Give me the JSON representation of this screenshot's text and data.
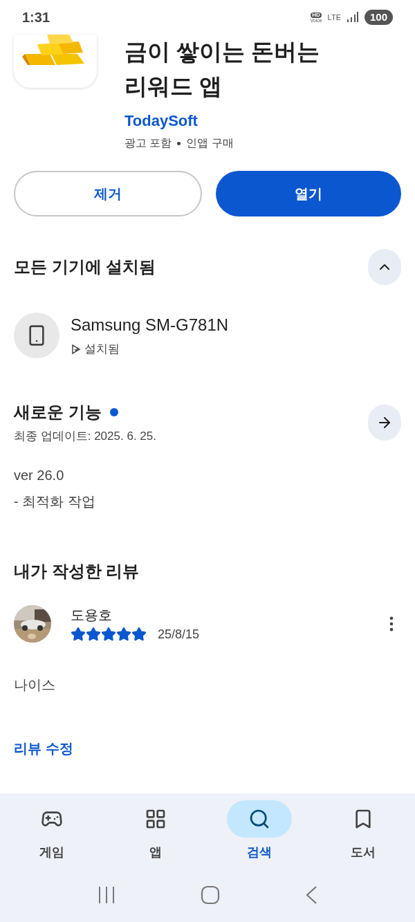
{
  "status_bar": {
    "time": "1:31",
    "hd": "HD",
    "voice": "Voice",
    "network": "LTE",
    "battery": "100"
  },
  "app": {
    "title_lines": [
      "금이 쌓이는 돈버는",
      "리워드 앱"
    ],
    "developer": "TodaySoft",
    "meta": [
      "광고 포함",
      "인앱 구매"
    ]
  },
  "buttons": [
    {
      "label": "제거",
      "kind": "outline"
    },
    {
      "label": "열기",
      "kind": "filled"
    }
  ],
  "installed_section": {
    "title": "모든 기기에 설치됨",
    "expanded": true,
    "device": {
      "name": "Samsung SM-G781N",
      "status": "설치됨"
    }
  },
  "whats_new": {
    "title": "새로운 기능",
    "new_badge": true,
    "updated": "최종 업데이트: 2025. 6. 25.",
    "lines": [
      "ver 26.0",
      "- 최적화 작업"
    ]
  },
  "my_review": {
    "title": "내가 작성한 리뷰",
    "author": "도용호",
    "stars": 5,
    "date": "25/8/15",
    "text": "나이스",
    "edit_link": "리뷰 수정"
  },
  "bottom_nav": [
    {
      "label": "게임",
      "kind": "games",
      "selected": false
    },
    {
      "label": "앱",
      "kind": "apps",
      "selected": false
    },
    {
      "label": "검색",
      "kind": "search",
      "selected": true
    },
    {
      "label": "도서",
      "kind": "books",
      "selected": false
    }
  ]
}
